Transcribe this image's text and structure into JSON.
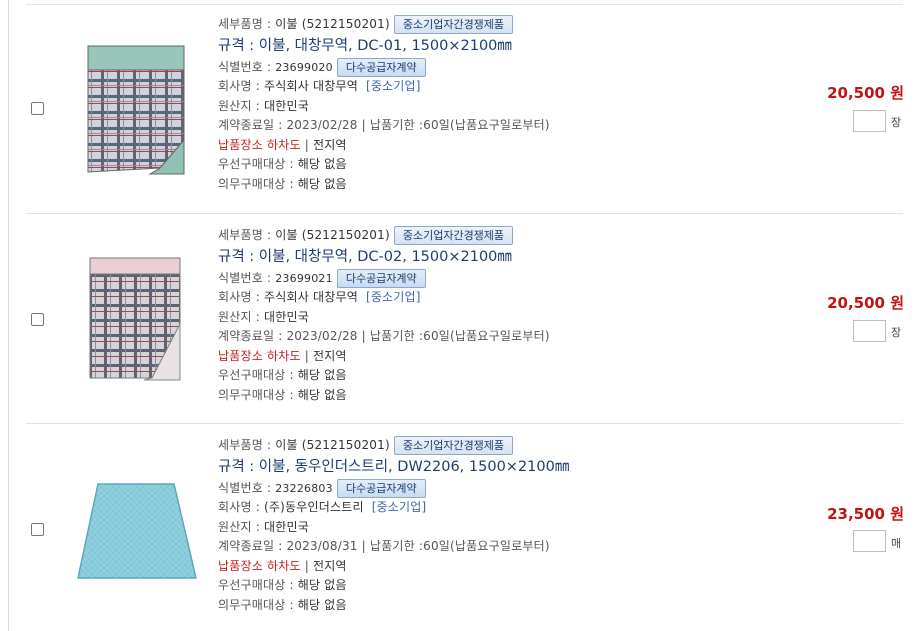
{
  "items": [
    {
      "detail_label": "세부품명 : ",
      "detail_value": "이불 (5212150201)",
      "badge_sme": "중소기업자간경쟁제품",
      "spec": "규격 : 이불, 대창무역, DC-01, 1500×2100㎜",
      "id_label": "식별번호 : ",
      "id_value": "23699020",
      "badge_contract": "다수공급자계약",
      "company_label": "회사명 : ",
      "company_value": "주식회사 대창무역",
      "company_tag": "[중소기업]",
      "origin_label": "원산지 : ",
      "origin_value": "대한민국",
      "contract_end": "계약종료일 : 2023/02/28",
      "delivery_term": "납품기한 :60일(납품요구일로부터)",
      "delivery_place": "납품장소 하차도",
      "delivery_region": "전지역",
      "priority_label": "우선구매대상 : ",
      "priority_value": "해당 없음",
      "mandatory_label": "의무구매대상 : ",
      "mandatory_value": "해당 없음",
      "price": "20,500 원",
      "unit": "장",
      "image": "plaid-blanket-teal"
    },
    {
      "detail_label": "세부품명 : ",
      "detail_value": "이불 (5212150201)",
      "badge_sme": "중소기업자간경쟁제품",
      "spec": "규격 : 이불, 대창무역, DC-02, 1500×2100㎜",
      "id_label": "식별번호 : ",
      "id_value": "23699021",
      "badge_contract": "다수공급자계약",
      "company_label": "회사명 : ",
      "company_value": "주식회사 대창무역",
      "company_tag": "[중소기업]",
      "origin_label": "원산지 : ",
      "origin_value": "대한민국",
      "contract_end": "계약종료일 : 2023/02/28",
      "delivery_term": "납품기한 :60일(납품요구일로부터)",
      "delivery_place": "납품장소 하차도",
      "delivery_region": "전지역",
      "priority_label": "우선구매대상 : ",
      "priority_value": "해당 없음",
      "mandatory_label": "의무구매대상 : ",
      "mandatory_value": "해당 없음",
      "price": "20,500 원",
      "unit": "장",
      "image": "plaid-blanket-pink"
    },
    {
      "detail_label": "세부품명 : ",
      "detail_value": "이불 (5212150201)",
      "badge_sme": "중소기업자간경쟁제품",
      "spec": "규격 : 이불, 동우인더스트리, DW2206, 1500×2100㎜",
      "id_label": "식별번호 : ",
      "id_value": "23226803",
      "badge_contract": "다수공급자계약",
      "company_label": "회사명 : ",
      "company_value": "(주)동우인더스트리",
      "company_tag": "[중소기업]",
      "origin_label": "원산지 : ",
      "origin_value": "대한민국",
      "contract_end": "계약종료일 : 2023/08/31",
      "delivery_term": "납품기한 :60일(납품요구일로부터)",
      "delivery_place": "납품장소 하차도",
      "delivery_region": "전지역",
      "priority_label": "우선구매대상 : ",
      "priority_value": "해당 없음",
      "mandatory_label": "의무구매대상 : ",
      "mandatory_value": "해당 없음",
      "price": "23,500 원",
      "unit": "매",
      "image": "quilted-blanket-sky-blue"
    }
  ],
  "colors": {
    "title": "#1f3d73",
    "price": "#c41212",
    "delivery_place": "#c62020",
    "sme_tag": "#3f66b3"
  }
}
